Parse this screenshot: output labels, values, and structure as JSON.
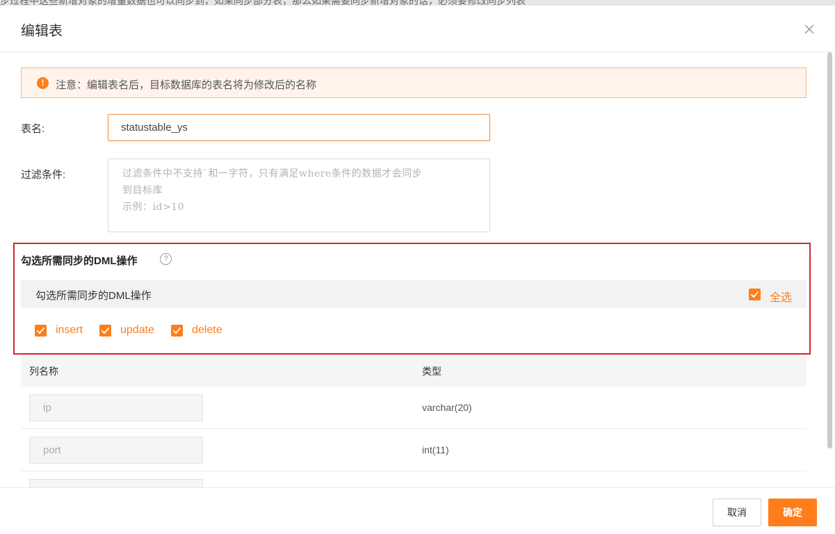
{
  "background": {
    "partial_text": "步过程中这些新增对象的增量数据也可以同步到，如果同步部分表，那么如果需要同步新增对象的话，必须要修改同步列表"
  },
  "dialog": {
    "title": "编辑表",
    "close_icon": "close-icon",
    "notice": {
      "icon": "warning-icon",
      "text": "注意：编辑表名后，目标数据库的表名将为修改后的名称"
    },
    "table_name": {
      "label": "表名:",
      "value": "statustable_ys"
    },
    "filter": {
      "label": "过滤条件:",
      "placeholder": "过滤条件中不支持`和一字符，只有满足where条件的数据才会同步\n到目标库\n示例：id>10"
    },
    "dml": {
      "title": "勾选所需同步的DML操作",
      "help_icon": "question-circle-icon",
      "bar_label": "勾选所需同步的DML操作",
      "select_all": {
        "label": "全选",
        "checked": true
      },
      "options": [
        {
          "label": "insert",
          "checked": true
        },
        {
          "label": "update",
          "checked": true
        },
        {
          "label": "delete",
          "checked": true
        }
      ]
    },
    "columns_table": {
      "headers": [
        "列名称",
        "类型"
      ],
      "rows": [
        {
          "name": "ip",
          "type": "varchar(20)"
        },
        {
          "name": "port",
          "type": "int(11)"
        },
        {
          "name": "",
          "type": ""
        }
      ]
    },
    "footer": {
      "cancel_label": "取消",
      "ok_label": "确定"
    }
  },
  "colors": {
    "accent": "#ff7d1a",
    "highlight_box": "#d9242f",
    "notice_bg": "#fff3eb"
  }
}
